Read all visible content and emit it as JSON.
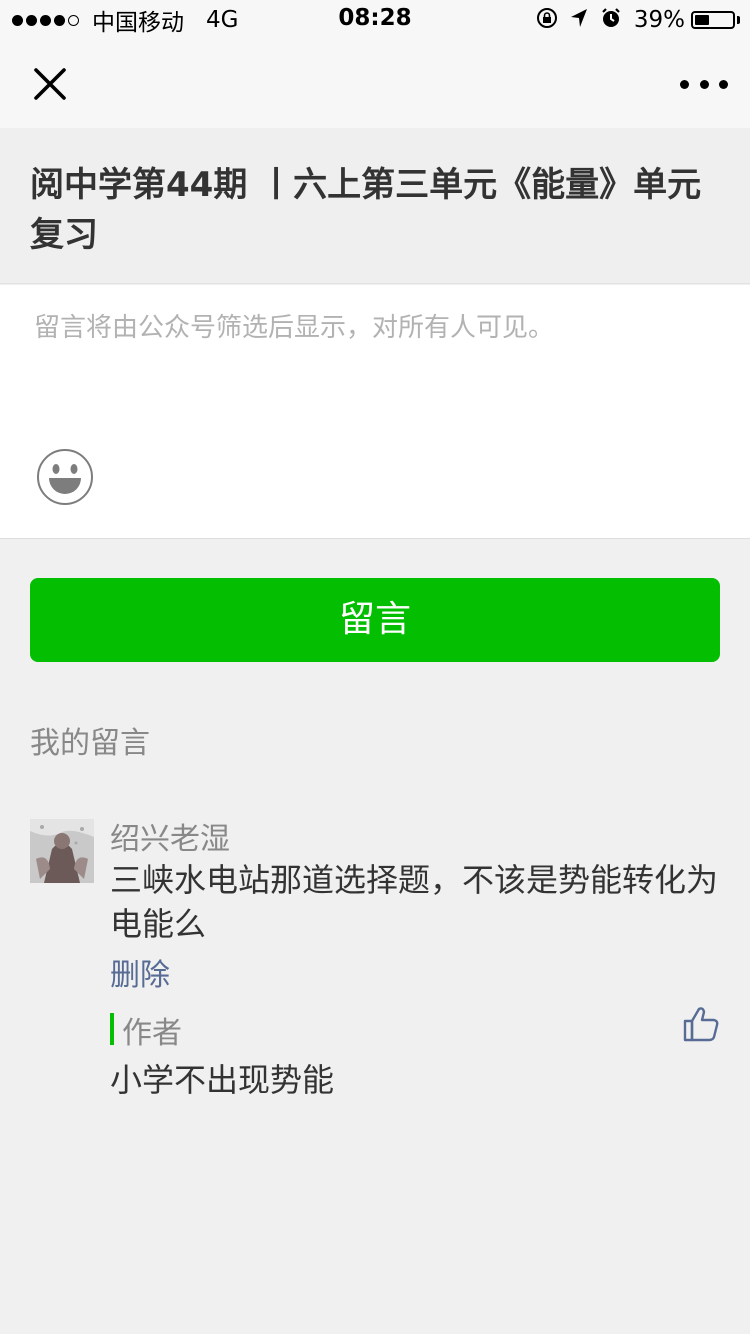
{
  "status_bar": {
    "carrier": "中国移动",
    "network": "4G",
    "time": "08:28",
    "battery_percent": "39%",
    "battery_level": 0.39,
    "signal_bars_filled": 4,
    "signal_bars_total": 5
  },
  "nav": {
    "close_icon": "close-icon",
    "more_icon": "more-dots-icon"
  },
  "article": {
    "title": "阅中学第44期 丨六上第三单元《能量》单元复习"
  },
  "comment_form": {
    "placeholder": "留言将由公众号筛选后显示，对所有人可见。",
    "value": "",
    "emoji_icon": "emoji-smile-icon",
    "submit_label": "留言"
  },
  "my_comments": {
    "section_title": "我的留言",
    "items": [
      {
        "username": "绍兴老湿",
        "text": "三峡水电站那道选择题，不该是势能转化为电能么",
        "delete_label": "删除",
        "reply": {
          "author_label": "作者",
          "text": "小学不出现势能"
        },
        "like_icon": "thumbs-up-icon"
      }
    ]
  },
  "colors": {
    "accent_green": "#04be02",
    "link_blue": "#576b95",
    "background": "#f0f0f0"
  }
}
